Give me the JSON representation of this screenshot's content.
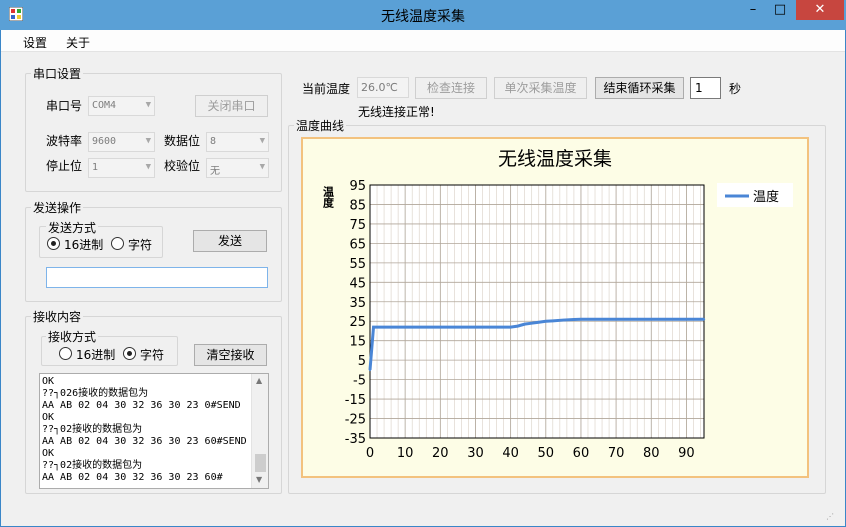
{
  "window": {
    "title": "无线温度采集",
    "controls": {
      "minimize": "–",
      "maximize": "□",
      "close": "✕"
    }
  },
  "menu": [
    "设置",
    "关于"
  ],
  "serial": {
    "group_title": "串口设置",
    "port_label": "串口号",
    "port_value": "COM4",
    "close_port_button": "关闭串口",
    "baud_label": "波特率",
    "baud_value": "9600",
    "databits_label": "数据位",
    "databits_value": "8",
    "stopbits_label": "停止位",
    "stopbits_value": "1",
    "parity_label": "校验位",
    "parity_value": "无"
  },
  "send": {
    "group_title": "发送操作",
    "mode_title": "发送方式",
    "hex_label": "16进制",
    "char_label": "字符",
    "selected": "hex",
    "send_button": "发送",
    "input_value": ""
  },
  "receive": {
    "group_title": "接收内容",
    "mode_title": "接收方式",
    "hex_label": "16进制",
    "char_label": "字符",
    "selected": "char",
    "clear_button": "清空接收",
    "lines": [
      "OK",
      "??┐026接收的数据包为",
      "AA AB 02 04 30 32 36 30 23 0#SEND",
      "OK",
      "??┐02接收的数据包为",
      "AA AB 02 04 30 32 36 30 23 60#SEND",
      "OK",
      "??┐02接收的数据包为",
      "AA AB 02 04 30 32 36 30 23 60#"
    ]
  },
  "toolbar": {
    "temp_label": "当前温度",
    "temp_value": "26.0℃",
    "check_button": "检查连接",
    "single_button": "单次采集温度",
    "loop_button": "结束循环采集",
    "interval_value": "1",
    "interval_unit": "秒",
    "status_text": "无线连接正常!"
  },
  "curve_group_title": "温度曲线",
  "chart_data": {
    "type": "line",
    "title": "无线温度采集",
    "ylabel": "温度",
    "xlabel": "",
    "xlim": [
      0,
      95
    ],
    "ylim": [
      -35,
      95
    ],
    "x_ticks": [
      0,
      10,
      20,
      30,
      40,
      50,
      60,
      70,
      80,
      90
    ],
    "y_ticks": [
      95,
      85,
      75,
      65,
      55,
      45,
      35,
      25,
      15,
      5,
      -5,
      -15,
      -25,
      -35
    ],
    "grid": true,
    "legend_position": "top-right",
    "series": [
      {
        "name": "温度",
        "color": "#4a86d6",
        "x": [
          0,
          1,
          10,
          20,
          30,
          40,
          42,
          44,
          46,
          48,
          50,
          52,
          55,
          58,
          60,
          70,
          80,
          90,
          95
        ],
        "y": [
          0,
          22,
          22,
          22,
          22,
          22,
          22.5,
          23.5,
          24,
          24.5,
          25,
          25.2,
          25.6,
          25.9,
          26,
          26,
          26,
          26,
          26
        ]
      }
    ]
  }
}
